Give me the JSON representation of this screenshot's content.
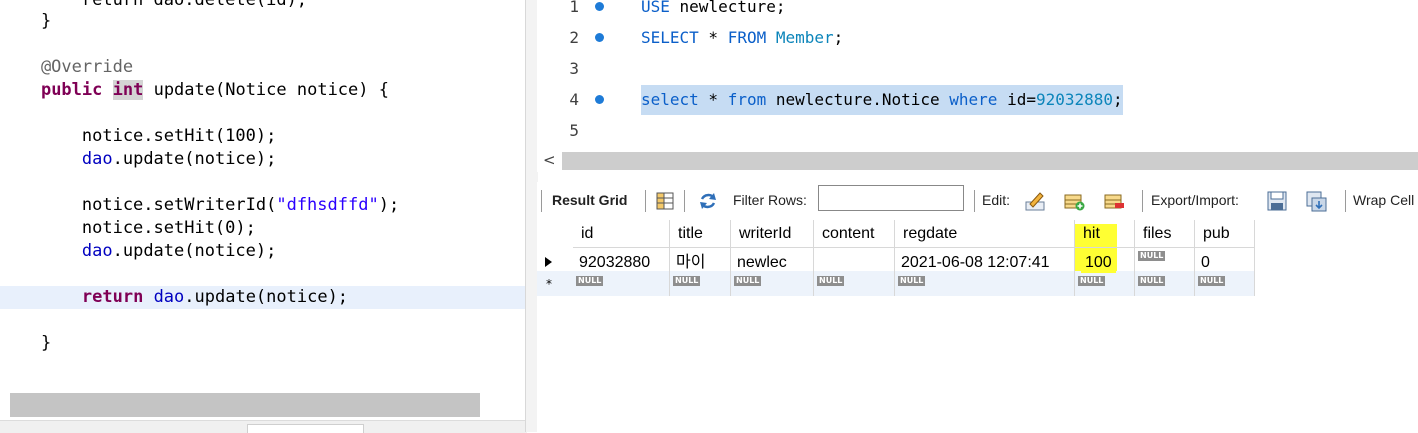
{
  "code_editor": {
    "lines": [
      {
        "segments": [
          {
            "t": "        return dao.delete(id);",
            "c": "cut"
          }
        ]
      },
      {
        "segments": [
          {
            "t": "    }",
            "c": ""
          }
        ]
      },
      {
        "segments": [
          {
            "t": "",
            "c": ""
          }
        ]
      },
      {
        "segments": [
          {
            "t": "    @Override",
            "c": "ann"
          }
        ]
      },
      {
        "segments": [
          {
            "t": "    ",
            "c": ""
          },
          {
            "t": "public",
            "c": "kw"
          },
          {
            "t": " ",
            "c": ""
          },
          {
            "t": "int",
            "c": "kw mark"
          },
          {
            "t": " update(Notice notice) {",
            "c": ""
          }
        ]
      },
      {
        "segments": [
          {
            "t": "",
            "c": ""
          }
        ]
      },
      {
        "segments": [
          {
            "t": "        notice.setHit(100);",
            "c": ""
          }
        ]
      },
      {
        "segments": [
          {
            "t": "        ",
            "c": ""
          },
          {
            "t": "dao",
            "c": "fld"
          },
          {
            "t": ".update(notice);",
            "c": ""
          }
        ]
      },
      {
        "segments": [
          {
            "t": "",
            "c": ""
          }
        ]
      },
      {
        "segments": [
          {
            "t": "        notice.setWriterId(",
            "c": ""
          },
          {
            "t": "\"dfhsdffd\"",
            "c": "str"
          },
          {
            "t": ");",
            "c": ""
          }
        ]
      },
      {
        "segments": [
          {
            "t": "        notice.setHit(0);",
            "c": ""
          }
        ]
      },
      {
        "segments": [
          {
            "t": "        ",
            "c": ""
          },
          {
            "t": "dao",
            "c": "fld"
          },
          {
            "t": ".update(notice);",
            "c": ""
          }
        ]
      },
      {
        "segments": [
          {
            "t": "",
            "c": ""
          }
        ]
      },
      {
        "segments": [
          {
            "t": "        ",
            "c": ""
          },
          {
            "t": "return",
            "c": "kw"
          },
          {
            "t": " ",
            "c": ""
          },
          {
            "t": "dao",
            "c": "fld"
          },
          {
            "t": ".update(notice);",
            "c": ""
          }
        ],
        "highlight": true
      },
      {
        "segments": [
          {
            "t": "",
            "c": ""
          }
        ]
      },
      {
        "segments": [
          {
            "t": "    }",
            "c": ""
          }
        ]
      }
    ]
  },
  "sql_editor": {
    "lines": [
      {
        "num": "1",
        "dot": true,
        "segments": [
          {
            "t": "USE",
            "c": "sk"
          },
          {
            "t": " newlecture;",
            "c": ""
          }
        ]
      },
      {
        "num": "2",
        "dot": true,
        "segments": [
          {
            "t": "SELECT",
            "c": "sk"
          },
          {
            "t": " * ",
            "c": ""
          },
          {
            "t": "FROM",
            "c": "sk"
          },
          {
            "t": " ",
            "c": ""
          },
          {
            "t": "Member",
            "c": "sn"
          },
          {
            "t": ";",
            "c": ""
          }
        ]
      },
      {
        "num": "3",
        "dot": false,
        "segments": []
      },
      {
        "num": "4",
        "dot": true,
        "selected": true,
        "segments": [
          {
            "t": "select",
            "c": "sk"
          },
          {
            "t": " * ",
            "c": ""
          },
          {
            "t": "from",
            "c": "sk"
          },
          {
            "t": " newlecture.Notice ",
            "c": ""
          },
          {
            "t": "where",
            "c": "sk"
          },
          {
            "t": " id=",
            "c": ""
          },
          {
            "t": "92032880",
            "c": "sn"
          },
          {
            "t": ";",
            "c": ""
          }
        ]
      },
      {
        "num": "5",
        "dot": false,
        "segments": []
      }
    ],
    "scroll_left_arrow": "<"
  },
  "result_toolbar": {
    "result_grid_label": "Result Grid",
    "filter_rows_label": "Filter Rows:",
    "filter_value": "",
    "edit_label": "Edit:",
    "export_import_label": "Export/Import:",
    "wrap_label": "Wrap Cell"
  },
  "result_grid": {
    "columns": [
      "id",
      "title",
      "writerId",
      "content",
      "regdate",
      "hit",
      "files",
      "pub"
    ],
    "null_label": "NULL",
    "rows": [
      {
        "id": "92032880",
        "title": "마이",
        "writerId": "newlec",
        "content": "",
        "regdate": "2021-06-08 12:07:41",
        "hit": "100",
        "files": "NULL",
        "pub": "0"
      }
    ],
    "new_row_marker": "*"
  },
  "colors": {
    "keyword_java": "#7f0055",
    "keyword_sql": "#0b5fc9",
    "string": "#2a00ff",
    "selection": "#c6dcf3",
    "hit_highlight": "#ffff33"
  }
}
